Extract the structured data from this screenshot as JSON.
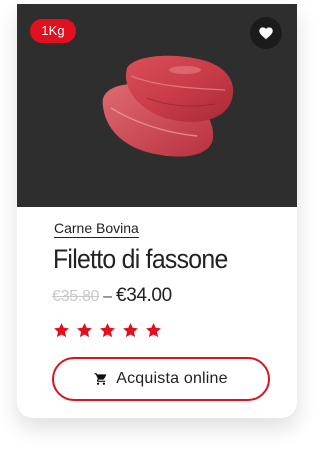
{
  "product": {
    "weight_badge": "1Kg",
    "category": "Carne Bovina",
    "title": "Filetto di fassone",
    "old_price": "€35.80",
    "price_separator": "–",
    "current_price": "€34.00",
    "rating": 5,
    "rating_max": 5,
    "buy_label": "Acquista online"
  },
  "icons": {
    "wishlist": "heart-icon",
    "cart": "cart-icon",
    "star": "star-icon"
  },
  "colors": {
    "accent": "#e1101e",
    "image_background": "#2e2e2e",
    "text": "#222222",
    "old_price": "#c8c8c8"
  }
}
